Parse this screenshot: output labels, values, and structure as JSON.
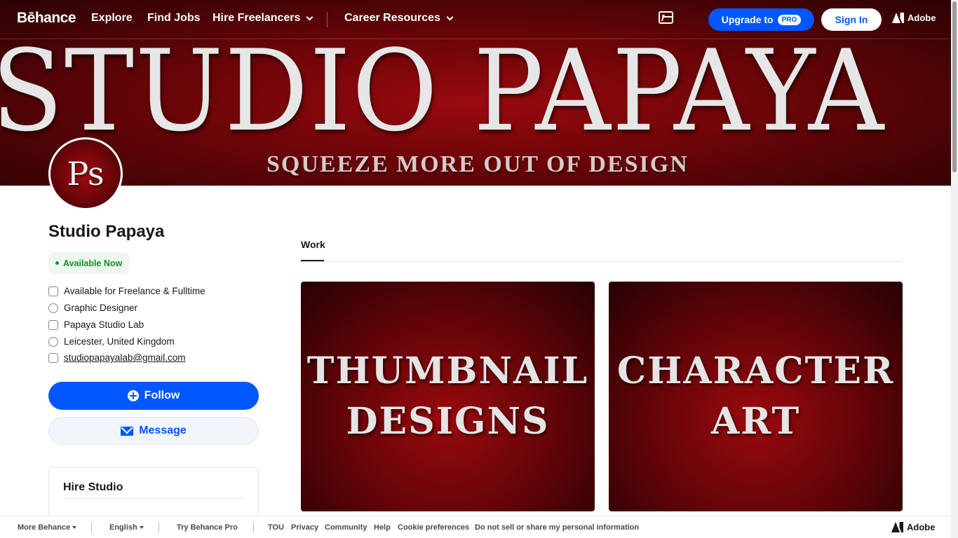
{
  "header": {
    "logo": "Bēhance",
    "nav": [
      "Explore",
      "Find Jobs",
      "Hire Freelancers",
      "Career Resources"
    ],
    "upgrade_label": "Upgrade to",
    "pro_badge": "PRO",
    "signin_label": "Sign In",
    "adobe_label": "Adobe"
  },
  "banner": {
    "title": "STUDIO PAPAYA",
    "tagline": "SQUEEZE MORE OUT OF DESIGN"
  },
  "avatar": {
    "text": "Ps"
  },
  "profile": {
    "name": "Studio Papaya",
    "availability": "Available Now",
    "info": [
      {
        "icon": "building-icon",
        "text": "Available for Freelance & Fulltime"
      },
      {
        "icon": "clock-icon",
        "text": "Graphic Designer"
      },
      {
        "icon": "briefcase-icon",
        "text": "Papaya Studio Lab"
      },
      {
        "icon": "globe-icon",
        "text": "Leicester, United Kingdom"
      },
      {
        "icon": "external-link-icon",
        "text": "studiopapayalab@gmail.com"
      }
    ],
    "follow_label": "Follow",
    "message_label": "Message",
    "hire_title": "Hire Studio"
  },
  "tabs": {
    "work": "Work"
  },
  "projects": [
    {
      "lines": [
        "THUMBNAIL",
        "DESIGNS"
      ]
    },
    {
      "lines": [
        "CHARACTER",
        "ART"
      ]
    }
  ],
  "footer": {
    "more": "More Behance",
    "language": "English",
    "try_pro": "Try Behance Pro",
    "links": [
      "TOU",
      "Privacy",
      "Community",
      "Help",
      "Cookie preferences",
      "Do not sell or share my personal information"
    ],
    "adobe": "Adobe"
  },
  "colors": {
    "accent": "#0057ff",
    "banner_red": "#7a0508",
    "available_green": "#1a8d2a"
  }
}
